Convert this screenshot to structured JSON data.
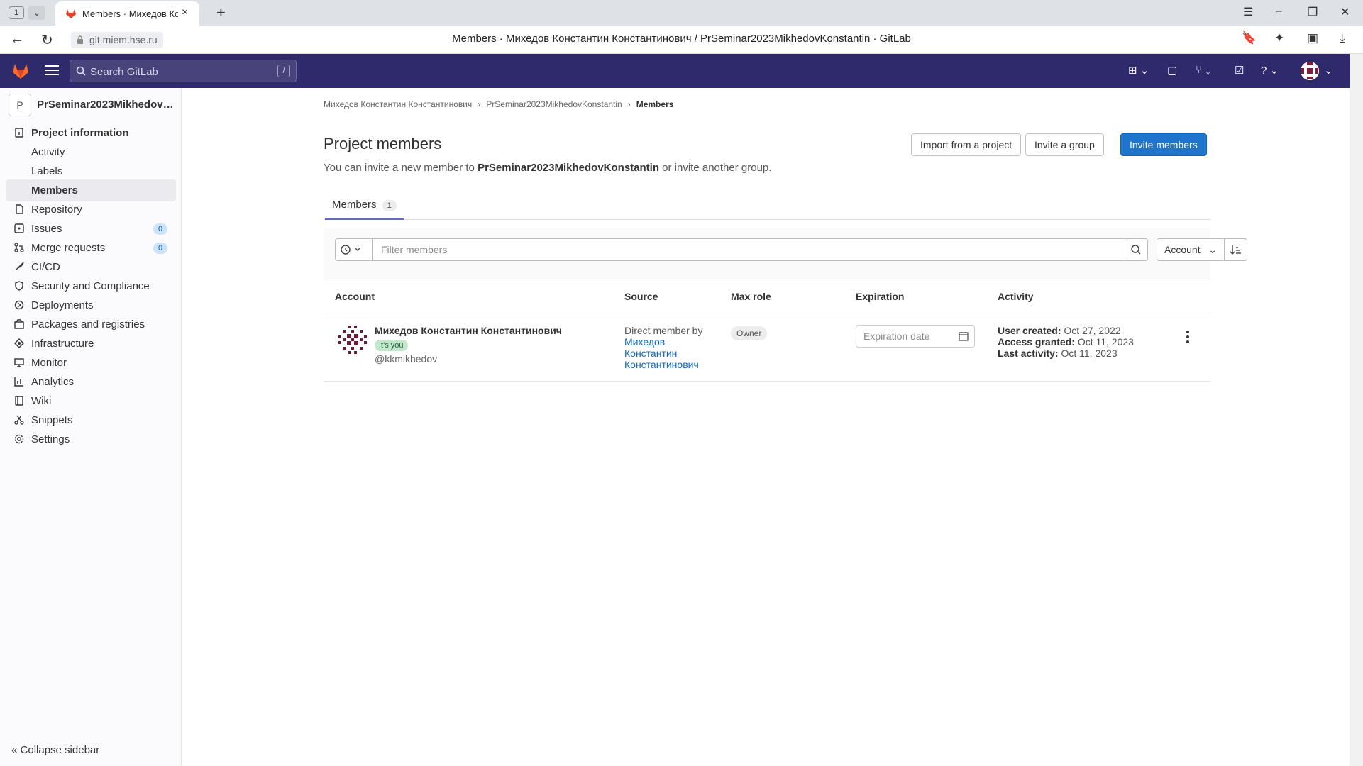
{
  "browser": {
    "tab_count": "1",
    "tab_title": "Members · Михедов Ко",
    "url": "git.miem.hse.ru",
    "page_title": "Members · Михедов Константин Константинович / PrSeminar2023MikhedovKonstantin · GitLab"
  },
  "header": {
    "search_placeholder": "Search GitLab",
    "search_shortcut": "/"
  },
  "sidebar": {
    "project_initial": "P",
    "project_name": "PrSeminar2023Mikhedov…",
    "items": [
      {
        "label": "Project information",
        "icon": "info-icon"
      },
      {
        "label": "Activity"
      },
      {
        "label": "Labels"
      },
      {
        "label": "Members"
      },
      {
        "label": "Repository",
        "icon": "file-icon"
      },
      {
        "label": "Issues",
        "icon": "issues-icon",
        "badge": "0"
      },
      {
        "label": "Merge requests",
        "icon": "merge-request-icon",
        "badge": "0"
      },
      {
        "label": "CI/CD",
        "icon": "rocket-icon"
      },
      {
        "label": "Security and Compliance",
        "icon": "shield-icon"
      },
      {
        "label": "Deployments",
        "icon": "deployments-icon"
      },
      {
        "label": "Packages and registries",
        "icon": "package-icon"
      },
      {
        "label": "Infrastructure",
        "icon": "infrastructure-icon"
      },
      {
        "label": "Monitor",
        "icon": "monitor-icon"
      },
      {
        "label": "Analytics",
        "icon": "chart-icon"
      },
      {
        "label": "Wiki",
        "icon": "book-icon"
      },
      {
        "label": "Snippets",
        "icon": "scissors-icon"
      },
      {
        "label": "Settings",
        "icon": "gear-icon"
      }
    ],
    "collapse_label": "Collapse sidebar"
  },
  "main": {
    "breadcrumb": [
      "Михедов Константин Константинович",
      "PrSeminar2023MikhedovKonstantin",
      "Members"
    ],
    "title": "Project members",
    "subline_prefix": "You can invite a new member to ",
    "subline_project": "PrSeminar2023MikhedovKonstantin",
    "subline_suffix": " or invite another group.",
    "buttons": {
      "import": "Import from a project",
      "invite_group": "Invite a group",
      "invite_members": "Invite members"
    },
    "tab": {
      "label": "Members",
      "count": "1"
    },
    "filter_placeholder": "Filter members",
    "sort_label": "Account",
    "columns": [
      "Account",
      "Source",
      "Max role",
      "Expiration",
      "Activity"
    ],
    "row": {
      "name": "Михедов Константин Константинович",
      "its_you": "It's you",
      "username": "@kkmikhedov",
      "source_prefix": "Direct member by",
      "source_link_1": "Михедов",
      "source_link_2": "Константин",
      "source_link_3": "Константинович",
      "role": "Owner",
      "expiration_placeholder": "Expiration date",
      "user_created_label": "User created:",
      "user_created": "Oct 27, 2022",
      "access_granted_label": "Access granted:",
      "access_granted": "Oct 11, 2023",
      "last_activity_label": "Last activity:",
      "last_activity": "Oct 11, 2023"
    }
  },
  "colors": {
    "header_bg": "#2f2a6b",
    "primary": "#1f75cb",
    "link": "#1068bf",
    "tab_underline": "#6666c4"
  }
}
